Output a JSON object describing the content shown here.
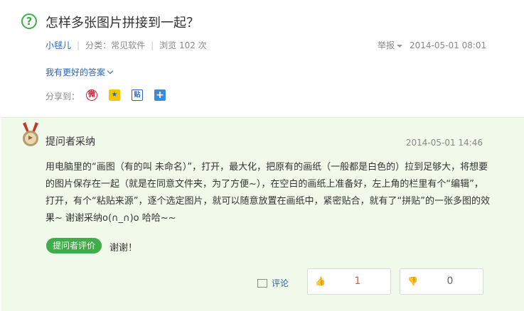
{
  "question": {
    "title": "怎样多张图片拼接到一起？",
    "author": "小毬儿",
    "category": "分类：常见软件",
    "views": "浏览 102 次",
    "report_label": "举报",
    "time": "2014-05-01 08:01",
    "better_answer_link": "我有更好的答案",
    "share_label": "分享到：",
    "share_icons": [
      "weibo-icon",
      "qzone-icon",
      "tieba-icon",
      "more-share-icon"
    ]
  },
  "answer": {
    "title": "提问者采纳",
    "time": "2014-05-01 14:46",
    "body": "用电脑里的“画图（有的叫 未命名）”，打开，最大化，把原有的画纸（一般都是白色的）拉到足够大，将想要的图片保存在一起（就是在同意文件夹，为了方便~），在空白的画纸上准备好，左上角的栏里有个“编辑”，打开，有个“粘贴来源”，逐个选定图片，就可以随意放置在画纸中，紧密贴合，就有了“拼贴”的一张多图的效果~   谢谢采纳o(∩_∩)o 哈哈~~",
    "rating_badge": "提问者评价",
    "rating_text": "谢谢！",
    "comment_label": "评论",
    "upvotes": "1",
    "downvotes": "0"
  },
  "colors": {
    "accent_green": "#3fae49",
    "link_blue": "#2d64b3",
    "answer_bg": "#f0f9ea"
  }
}
